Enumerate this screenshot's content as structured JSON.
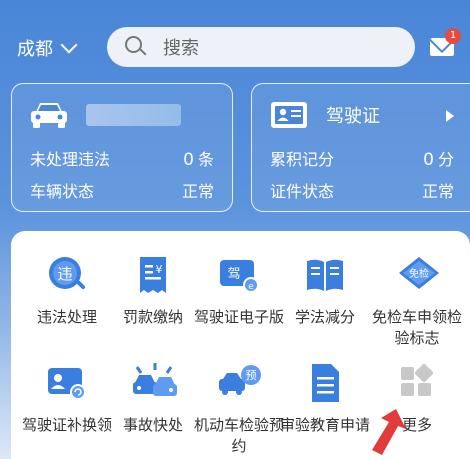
{
  "header": {
    "city": "成都",
    "search_placeholder": "搜索",
    "mail_badge": "1"
  },
  "vehicle_card": {
    "violations_label": "未处理违法",
    "violations_count": "0",
    "violations_unit": "条",
    "status_label": "车辆状态",
    "status_value": "正常"
  },
  "license_card": {
    "title": "驾驶证",
    "points_label": "累积记分",
    "points_value": "0",
    "points_unit": "分",
    "status_label": "证件状态",
    "status_value": "正常"
  },
  "services": [
    {
      "label": "违法处理",
      "icon": "violation-icon"
    },
    {
      "label": "罚款缴纳",
      "icon": "fine-receipt-icon"
    },
    {
      "label": "驾驶证电子版",
      "icon": "e-license-icon"
    },
    {
      "label": "学法减分",
      "icon": "book-icon"
    },
    {
      "label": "免检车申领检验标志",
      "icon": "inspection-exempt-icon"
    },
    {
      "label": "驾驶证补换领",
      "icon": "license-replace-icon"
    },
    {
      "label": "事故快处",
      "icon": "accident-icon"
    },
    {
      "label": "机动车检验预约",
      "icon": "inspection-booking-icon"
    },
    {
      "label": "审验教育申请",
      "icon": "document-icon"
    },
    {
      "label": "更多",
      "icon": "more-grid-icon"
    }
  ],
  "colors": {
    "brand_blue": "#4a86d8",
    "icon_blue": "#3a7ee0",
    "badge_red": "#e84a3d"
  }
}
